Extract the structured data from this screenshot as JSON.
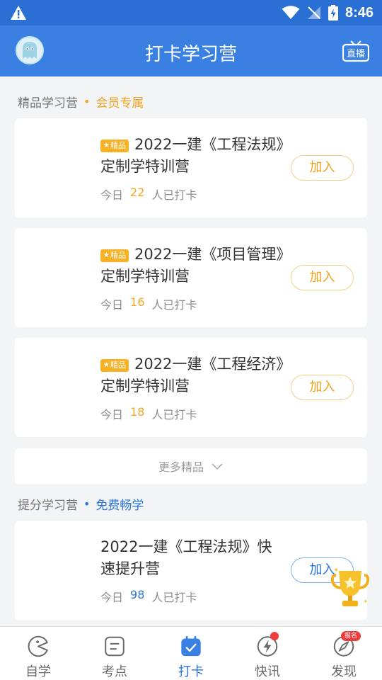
{
  "status_bar": {
    "time": "8:46"
  },
  "header": {
    "title": "打卡学习营",
    "live_label": "直播"
  },
  "premium_section": {
    "title": "精品学习营",
    "tag": "会员专属"
  },
  "premium_camps": [
    {
      "badge": "精品",
      "title": "2022一建《工程法规》定制学特训营",
      "meta_prefix": "今日",
      "count": "22",
      "meta_suffix": "人已打卡",
      "join_label": "加入"
    },
    {
      "badge": "精品",
      "title": "2022一建《项目管理》定制学特训营",
      "meta_prefix": "今日",
      "count": "16",
      "meta_suffix": "人已打卡",
      "join_label": "加入"
    },
    {
      "badge": "精品",
      "title": "2022一建《工程经济》定制学特训营",
      "meta_prefix": "今日",
      "count": "18",
      "meta_suffix": "人已打卡",
      "join_label": "加入"
    }
  ],
  "more_premium": "更多精品",
  "boost_section": {
    "title": "提分学习营",
    "tag": "免费畅学"
  },
  "boost_camps": [
    {
      "title": "2022一建《工程法规》快速提升营",
      "meta_prefix": "今日",
      "count": "98",
      "meta_suffix": "人已打卡",
      "join_label": "加入"
    }
  ],
  "bottom_nav": [
    {
      "label": "自学",
      "icon": "self-study-icon",
      "active": false
    },
    {
      "label": "考点",
      "icon": "exam-points-icon",
      "active": false
    },
    {
      "label": "打卡",
      "icon": "checkin-icon",
      "active": true
    },
    {
      "label": "快讯",
      "icon": "news-flash-icon",
      "active": false,
      "dot": true
    },
    {
      "label": "发现",
      "icon": "discover-compass-icon",
      "active": false,
      "badge": "报名"
    }
  ],
  "colors": {
    "primary": "#3a80e2",
    "accent_orange": "#f0a21e",
    "accent_blue": "#2a73d8"
  }
}
